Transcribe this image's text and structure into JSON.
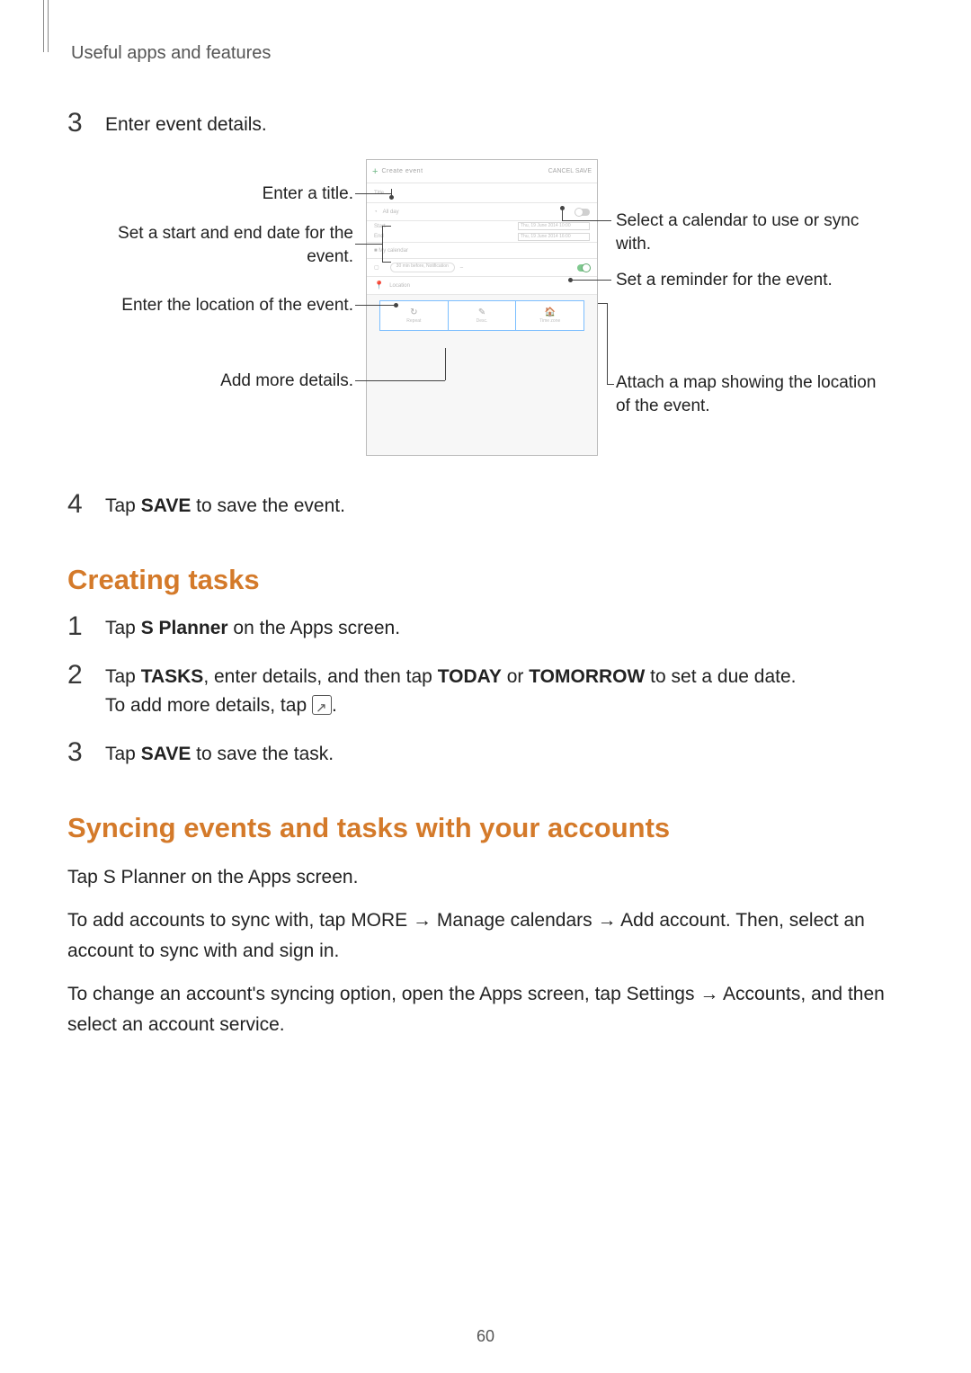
{
  "breadcrumb": "Useful apps and features",
  "page_number": "60",
  "section_a": {
    "steps": [
      {
        "num": "3",
        "text": "Enter event details."
      },
      {
        "num": "4",
        "prefix": "Tap ",
        "bold1": "SAVE",
        "suffix": " to save the event."
      }
    ]
  },
  "fig": {
    "callouts_left": {
      "title": "Enter a title.",
      "dates": "Set a start and end date for the event.",
      "location": "Enter the location of the event.",
      "more": "Add more details."
    },
    "callouts_right": {
      "calendar": "Select a calendar to use or sync with.",
      "reminder": "Set a reminder for the event.",
      "map": "Attach a map showing the location of the event."
    },
    "phone": {
      "create": "Create event",
      "cancel_save": "CANCEL    SAVE",
      "title_ph": "Title",
      "allday": "All day",
      "start": "Start",
      "end": "End",
      "dt1": "Thu, 19 June 2014   10:00",
      "dt2": "Thu, 19 June 2014   16:00",
      "mycal": "■  My calendar",
      "reminder": "30 min before, Notification",
      "loc": "Location",
      "tab_repeat": "Repeat",
      "tab_desc": "Desc.",
      "tab_tz": "Time zone"
    }
  },
  "h2_tasks": "Creating tasks",
  "tasks_steps": {
    "s1": {
      "num": "1",
      "pre": "Tap ",
      "b1": "S Planner",
      "post": " on the Apps screen."
    },
    "s2": {
      "num": "2",
      "line1_pre": "Tap ",
      "b_tasks": "TASKS",
      "line1_mid": ", enter details, and then tap ",
      "b_today": "TODAY",
      "line1_or": " or ",
      "b_tom": "TOMORROW",
      "line1_end": " to set a due date.",
      "line2_pre": "To add more details, tap ",
      "line2_end": "."
    },
    "s3": {
      "num": "3",
      "pre": "Tap ",
      "b1": "SAVE",
      "post": " to save the task."
    }
  },
  "h2_sync": "Syncing events and tasks with your accounts",
  "sync_p1": {
    "pre": "Tap ",
    "b1": "S Planner",
    "post": " on the Apps screen."
  },
  "sync_p2": {
    "pre": "To add accounts to sync with, tap ",
    "b_more": "MORE",
    "arr1": " → ",
    "b_mc": "Manage calendars",
    "arr2": " → ",
    "b_add": "Add account",
    "post": ". Then, select an account to sync with and sign in."
  },
  "sync_p3": {
    "pre": "To change an account's syncing option, open the Apps screen, tap ",
    "b_set": "Settings",
    "arr": " → ",
    "b_acc": "Accounts",
    "post": ", and then select an account service."
  }
}
